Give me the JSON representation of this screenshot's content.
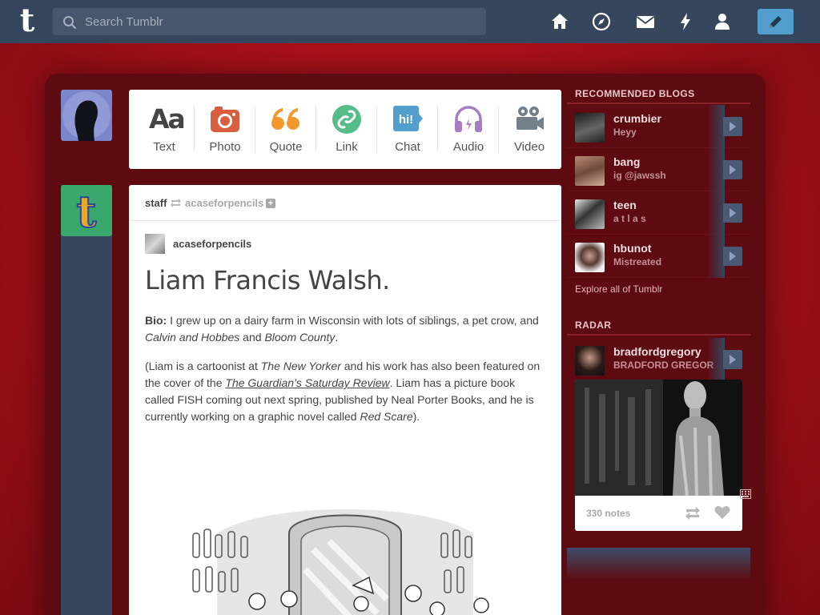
{
  "header": {
    "logo": "t",
    "search_placeholder": "Search Tumblr",
    "nav": [
      "home-icon",
      "explore-icon",
      "inbox-icon",
      "activity-icon",
      "account-icon"
    ],
    "compose_icon": "pencil-icon"
  },
  "post_types": [
    {
      "label": "Text",
      "glyph": "Aa",
      "color": "#444444",
      "icon": "text-icon"
    },
    {
      "label": "Photo",
      "glyph": "",
      "color": "#d95e40",
      "icon": "camera-icon"
    },
    {
      "label": "Quote",
      "glyph": "66",
      "color": "#f2992e",
      "icon": "quote-icon"
    },
    {
      "label": "Link",
      "glyph": "",
      "color": "#56bc8a",
      "icon": "link-icon"
    },
    {
      "label": "Chat",
      "glyph": "hi!",
      "color": "#529ecc",
      "icon": "chat-icon"
    },
    {
      "label": "Audio",
      "glyph": "",
      "color": "#a77dc2",
      "icon": "headphones-icon"
    },
    {
      "label": "Video",
      "glyph": "",
      "color": "#748089",
      "icon": "video-camera-icon"
    }
  ],
  "post": {
    "reblogger": "staff",
    "source": "acaseforpencils",
    "original_author": "acaseforpencils",
    "title": "Liam Francis Walsh.",
    "bio_label": "Bio:",
    "bio_text": " I grew up on a dairy farm in Wisconsin with lots of siblings, a pet crow, and ",
    "bio_book1": "Calvin and Hobbes",
    "bio_and": " and ",
    "bio_book2": "Bloom County",
    "bio_end": ".",
    "p2_a": "(Liam is a cartoonist at ",
    "p2_newyorker": "The New Yorker",
    "p2_b": " and his work has also been featured on the cover of the ",
    "p2_guardian": "The Guardian’s Saturday Review",
    "p2_c": ". Liam has a picture book called FISH coming out next spring, published by Neal Porter Books, and he is currently working on a graphic novel called ",
    "p2_redscare": "Red Scare",
    "p2_d": ")."
  },
  "sidebar": {
    "recommended_heading": "RECOMMENDED BLOGS",
    "blogs": [
      {
        "name": "crumbier",
        "sub": "Heyy"
      },
      {
        "name": "bang",
        "sub": "ig @jawssh"
      },
      {
        "name": "teen",
        "sub": "a t l a s"
      },
      {
        "name": "hbunot",
        "sub": "Mistreated"
      }
    ],
    "explore": "Explore all of Tumblr",
    "radar_heading": "RADAR",
    "radar_blog": {
      "name": "bradfordgregory",
      "sub": "BRADFORD GREGOR"
    },
    "radar_notes": "330 notes"
  },
  "colors": {
    "header_bg": "#36465d",
    "accent_blue": "#529ecc",
    "page_red": "#b0121b"
  }
}
